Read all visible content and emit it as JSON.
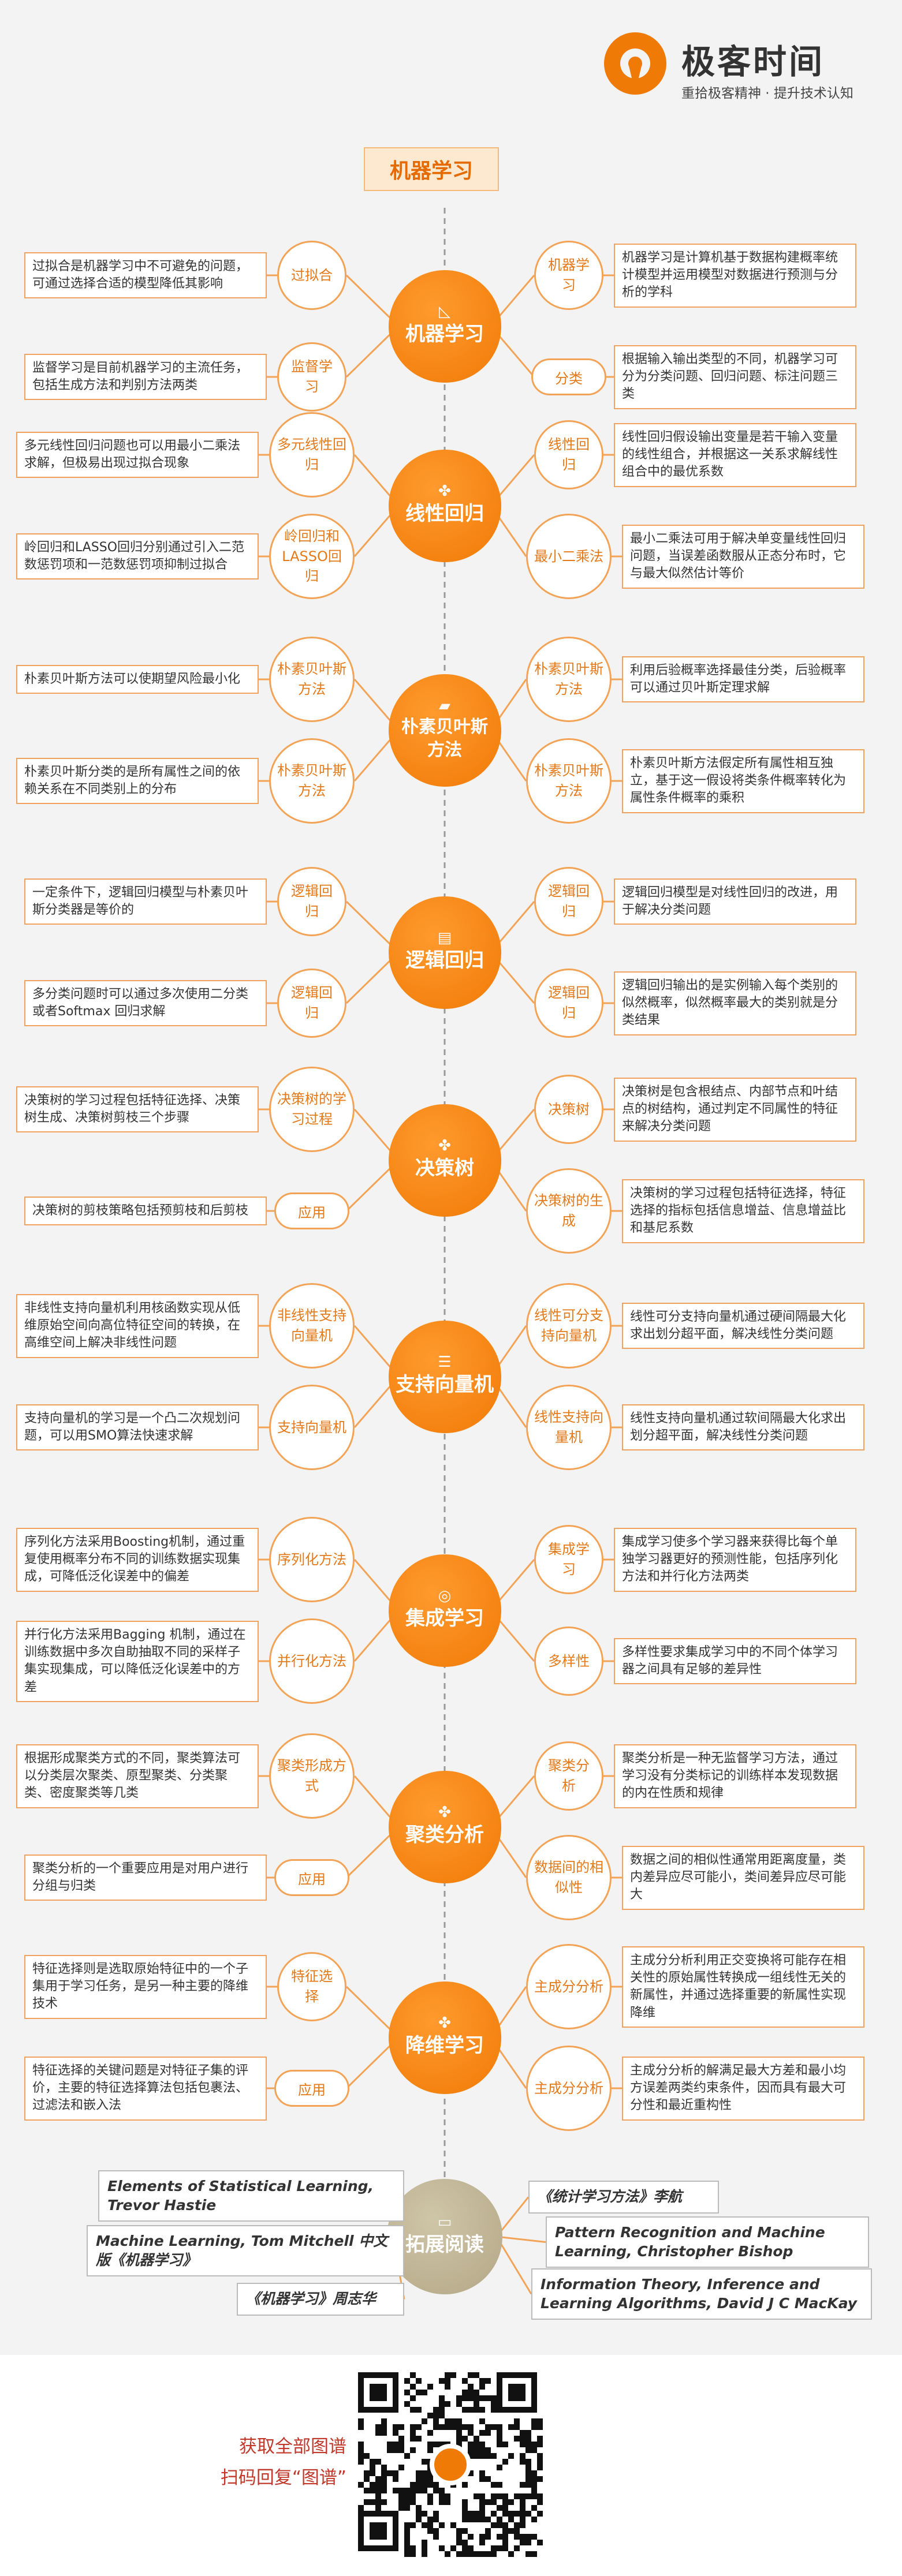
{
  "brand": {
    "name": "极客时间",
    "tagline": "重拾极客精神 · 提升技术认知"
  },
  "title": "机器学习",
  "colors": {
    "accent": "#f07a06",
    "accent_light": "#f3a356",
    "note_text": "#333333",
    "hub_gray": "#b3a785",
    "footer_text": "#c0392b"
  },
  "topics": [
    {
      "title": "机器学习",
      "icon": "triangle-ruler-icon",
      "left": [
        {
          "label": "过拟合",
          "note": "过拟合是机器学习中不可避免的问题，可通过选择合适的模型降低其影响"
        },
        {
          "label": "监督学习",
          "note": "监督学习是目前机器学习的主流任务，包括生成方法和判别方法两类"
        }
      ],
      "right": [
        {
          "label": "机器学习",
          "note": "机器学习是计算机基于数据构建概率统计模型并运用模型对数据进行预测与分析的学科"
        },
        {
          "label": "分类",
          "note": "根据输入输出类型的不同，机器学习可分为分类问题、回归问题、标注问题三类"
        }
      ]
    },
    {
      "title": "线性回归",
      "icon": "puzzle-icon",
      "left": [
        {
          "label": "多元线性回归",
          "note": "多元线性回归问题也可以用最小二乘法求解，但极易出现过拟合现象"
        },
        {
          "label": "岭回归和LASSO回归",
          "note": "岭回归和LASSO回归分别通过引入二范数惩罚项和一范数惩罚项抑制过拟合"
        }
      ],
      "right": [
        {
          "label": "线性回归",
          "note": "线性回归假设输出变量是若干输入变量的线性组合，并根据这一关系求解线性组合中的最优系数"
        },
        {
          "label": "最小二乘法",
          "note": "最小二乘法可用于解决单变量线性回归问题，当误差函数服从正态分布时，它与最大似然估计等价"
        }
      ]
    },
    {
      "title": "朴素贝叶斯方法",
      "icon": "folder-icon",
      "left": [
        {
          "label": "朴素贝叶斯方法",
          "note": "朴素贝叶斯方法可以使期望风险最小化"
        },
        {
          "label": "朴素贝叶斯方法",
          "note": "朴素贝叶斯分类的是所有属性之间的依赖关系在不同类别上的分布"
        }
      ],
      "right": [
        {
          "label": "朴素贝叶斯方法",
          "note": "利用后验概率选择最佳分类，后验概率可以通过贝叶斯定理求解"
        },
        {
          "label": "朴素贝叶斯方法",
          "note": "朴素贝叶斯方法假定所有属性相互独立，基于这一假设将类条件概率转化为属性条件概率的乘积"
        }
      ]
    },
    {
      "title": "逻辑回归",
      "icon": "film-icon",
      "left": [
        {
          "label": "逻辑回归",
          "note": "一定条件下，逻辑回归模型与朴素贝叶斯分类器是等价的"
        },
        {
          "label": "逻辑回归",
          "note": "多分类问题时可以通过多次使用二分类或者Softmax 回归求解"
        }
      ],
      "right": [
        {
          "label": "逻辑回归",
          "note": "逻辑回归模型是对线性回归的改进，用于解决分类问题"
        },
        {
          "label": "逻辑回归",
          "note": "逻辑回归输出的是实例输入每个类别的似然概率，似然概率最大的类别就是分类结果"
        }
      ]
    },
    {
      "title": "决策树",
      "icon": "puzzle-icon",
      "left": [
        {
          "label": "决策树的学习过程",
          "note": "决策树的学习过程包括特征选择、决策树生成、决策树剪枝三个步骤"
        },
        {
          "label": "应用",
          "note": "决策树的剪枝策略包括预剪枝和后剪枝"
        }
      ],
      "right": [
        {
          "label": "决策树",
          "note": "决策树是包含根结点、内部节点和叶结点的树结构，通过判定不同属性的特征来解决分类问题"
        },
        {
          "label": "决策树的生成",
          "note": "决策树的学习过程包括特征选择，特征选择的指标包括信息增益、信息增益比和基尼系数"
        }
      ]
    },
    {
      "title": "支持向量机",
      "icon": "stack-icon",
      "left": [
        {
          "label": "非线性支持向量机",
          "note": "非线性支持向量机利用核函数实现从低维原始空间向高位特征空间的转换，在高维空间上解决非线性问题"
        },
        {
          "label": "支持向量机",
          "note": "支持向量机的学习是一个凸二次规划问题，可以用SMO算法快速求解"
        }
      ],
      "right": [
        {
          "label": "线性可分支持向量机",
          "note": "线性可分支持向量机通过硬间隔最大化求出划分超平面，解决线性分类问题"
        },
        {
          "label": "线性支持向量机",
          "note": "线性支持向量机通过软间隔最大化求出划分超平面，解决线性分类问题"
        }
      ]
    },
    {
      "title": "集成学习",
      "icon": "search-icon",
      "left": [
        {
          "label": "序列化方法",
          "note": "序列化方法采用Boosting机制，通过重复使用概率分布不同的训练数据实现集成，可降低泛化误差中的偏差"
        },
        {
          "label": "并行化方法",
          "note": "并行化方法采用Bagging 机制，通过在训练数据中多次自助抽取不同的采样子集实现集成，可以降低泛化误差中的方差"
        }
      ],
      "right": [
        {
          "label": "集成学习",
          "note": "集成学习使多个学习器来获得比每个单独学习器更好的预测性能，包括序列化方法和并行化方法两类"
        },
        {
          "label": "多样性",
          "note": "多样性要求集成学习中的不同个体学习器之间具有足够的差异性"
        }
      ]
    },
    {
      "title": "聚类分析",
      "icon": "puzzle-icon",
      "left": [
        {
          "label": "聚类形成方式",
          "note": "根据形成聚类方式的不同，聚类算法可以分类层次聚类、原型聚类、分类聚类、密度聚类等几类"
        },
        {
          "label": "应用",
          "note": "聚类分析的一个重要应用是对用户进行分组与归类"
        }
      ],
      "right": [
        {
          "label": "聚类分析",
          "note": "聚类分析是一种无监督学习方法，通过学习没有分类标记的训练样本发现数据的内在性质和规律"
        },
        {
          "label": "数据间的相似性",
          "note": "数据之间的相似性通常用距离度量，类内差异应尽可能小，类间差异应尽可能大"
        }
      ]
    },
    {
      "title": "降维学习",
      "icon": "puzzle-icon",
      "left": [
        {
          "label": "特征选择",
          "note": "特征选择则是选取原始特征中的一个子集用于学习任务，是另一种主要的降维技术"
        },
        {
          "label": "应用",
          "note": "特征选择的关键问题是对特征子集的评价，主要的特征选择算法包括包裹法、过滤法和嵌入法"
        }
      ],
      "right": [
        {
          "label": "主成分分析",
          "note": "主成分分析利用正交变换将可能存在相关性的原始属性转换成一组线性无关的新属性，并通过选择重要的新属性实现降维"
        },
        {
          "label": "主成分分析",
          "note": "主成分分析的解满足最大方差和最小均方误差两类约束条件，因而具有最大可分性和最近重构性"
        }
      ]
    }
  ],
  "reading": {
    "title": "拓展阅读",
    "icon": "book-icon",
    "left": [
      "Elements of Statistical Learning, Trevor Hastie",
      "Machine Learning, Tom Mitchell  中文版《机器学习》",
      "《机器学习》周志华"
    ],
    "right": [
      "《统计学习方法》李航",
      "Pattern Recognition and Machine Learning, Christopher Bishop",
      "Information Theory, Inference and Learning Algorithms, David J C MacKay"
    ]
  },
  "footer": {
    "line1": "获取全部图谱",
    "line2": "扫码回复“图谱”"
  }
}
